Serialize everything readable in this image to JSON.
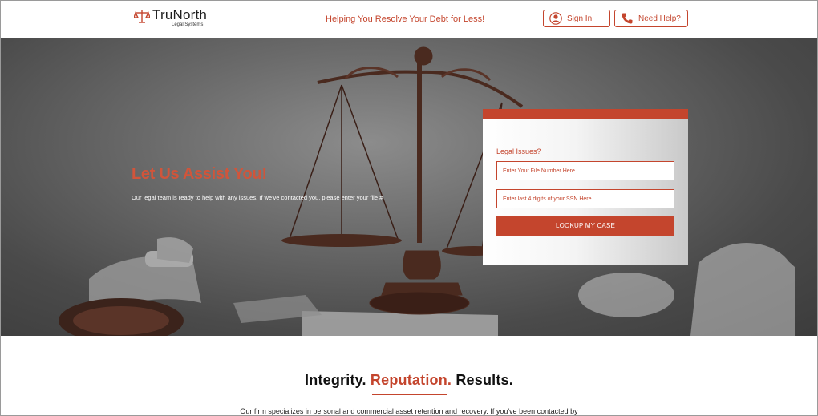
{
  "header": {
    "brand_name": "TruNorth",
    "brand_sub": "Legal Systems",
    "tagline": "Helping You Resolve Your Debt for Less!",
    "signin_label": "Sign In",
    "help_label": "Need Help?"
  },
  "hero": {
    "title": "Let Us Assist You!",
    "text": "Our legal team is ready to help with any issues. If we've contacted you, please enter your file #"
  },
  "form": {
    "label": "Legal Issues?",
    "file_placeholder": "Enter Your File Number Here",
    "ssn_placeholder": "Enter last 4 digits of your SSN Here",
    "submit_label": "LOOKUP MY CASE"
  },
  "section": {
    "word1": "Integrity.",
    "word2": "Reputation.",
    "word3": "Results.",
    "paragraph": "Our firm specializes in personal and commercial asset retention and recovery. If you've been contacted by"
  },
  "colors": {
    "accent": "#c4452d"
  },
  "icons": {
    "logo": "scales-icon",
    "signin": "user-icon",
    "help": "phone-icon"
  }
}
